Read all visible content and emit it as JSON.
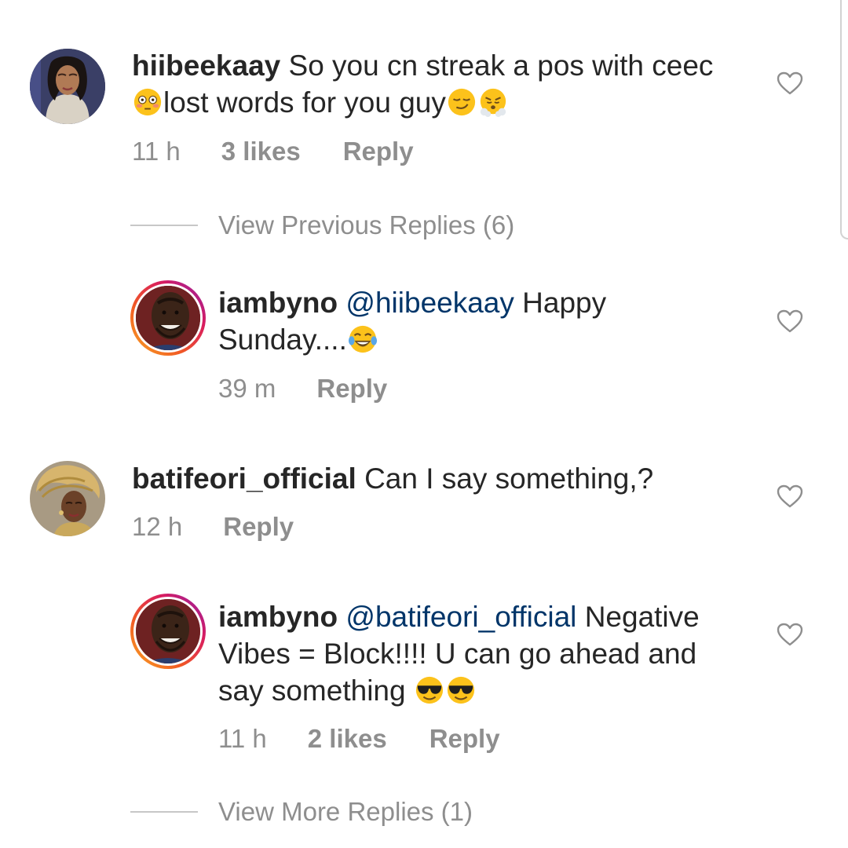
{
  "comments": [
    {
      "username": "hiibeekaay",
      "text_line1": "So you cn streak a pos with ceec",
      "text_line2": "lost words for you guy",
      "time": "11 h",
      "likes": "3 likes",
      "reply_label": "Reply",
      "avatar": "woman-portrait-avatar",
      "emojis": [
        "flushed-face-emoji",
        "smirking-face-emoji",
        "face-with-steam-emoji"
      ]
    },
    {
      "username": "batifeori_official",
      "text": "Can I say something,?",
      "time": "12 h",
      "reply_label": "Reply",
      "avatar": "gold-headwrap-portrait-avatar"
    }
  ],
  "replies": [
    {
      "username": "iambyno",
      "mention": "@hiibeekaay",
      "text_line1": "Happy",
      "text_line2": "Sunday....",
      "time": "39 m",
      "reply_label": "Reply",
      "emojis": [
        "tears-of-joy-emoji"
      ]
    },
    {
      "username": "iambyno",
      "mention": "@batifeori_official",
      "text_line1": "Negative",
      "text_line2": "Vibes = Block!!!! U can go ahead and",
      "text_line3": "say something",
      "time": "11 h",
      "likes": "2 likes",
      "reply_label": "Reply",
      "emojis": [
        "sunglasses-face-emoji",
        "sunglasses-face-emoji"
      ]
    }
  ],
  "view_previous_replies": "View Previous Replies (6)",
  "view_more_replies": "View More Replies (1)",
  "colors": {
    "text": "#262626",
    "meta": "#8e8e8e",
    "mention": "#003569",
    "story_ring": "#d81b60"
  }
}
